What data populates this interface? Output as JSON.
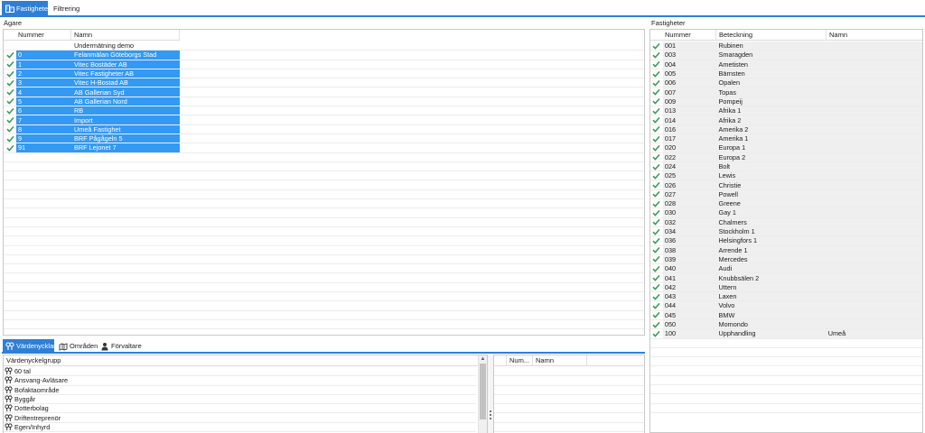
{
  "top_tabs": [
    {
      "label": "Fastigheter",
      "active": true
    },
    {
      "label": "Filtrering",
      "active": false
    }
  ],
  "owners": {
    "title": "Ägare",
    "columns": [
      "Nummer",
      "Namn"
    ],
    "rows": [
      {
        "num": "",
        "name": "Undermätning demo",
        "checked": false,
        "selected": false
      },
      {
        "num": "0",
        "name": "Felanmälan Göteborgs Stad",
        "checked": true,
        "selected": true
      },
      {
        "num": "1",
        "name": "Vitec Bostäder AB",
        "checked": true,
        "selected": true
      },
      {
        "num": "2",
        "name": "Vitec Fastigheter AB",
        "checked": true,
        "selected": true
      },
      {
        "num": "3",
        "name": "Vitec H-Bostad AB",
        "checked": true,
        "selected": true
      },
      {
        "num": "4",
        "name": "AB Gallerian Syd",
        "checked": true,
        "selected": true
      },
      {
        "num": "5",
        "name": "AB Gallerian Nord",
        "checked": true,
        "selected": true
      },
      {
        "num": "6",
        "name": "RB",
        "checked": true,
        "selected": true
      },
      {
        "num": "7",
        "name": "Import",
        "checked": true,
        "selected": true
      },
      {
        "num": "8",
        "name": "Umeå Fastighet",
        "checked": true,
        "selected": true
      },
      {
        "num": "9",
        "name": "BRF Pågågeln 5",
        "checked": true,
        "selected": true
      },
      {
        "num": "91",
        "name": "BRF Lejonet 7",
        "checked": true,
        "selected": true
      }
    ]
  },
  "properties": {
    "title": "Fastigheter",
    "columns": [
      "Nummer",
      "Beteckning",
      "Namn"
    ],
    "rows": [
      {
        "num": "001",
        "name": "Rubinen",
        "extra": ""
      },
      {
        "num": "003",
        "name": "Smaragden",
        "extra": ""
      },
      {
        "num": "004",
        "name": "Ametisten",
        "extra": ""
      },
      {
        "num": "005",
        "name": "Bärnsten",
        "extra": ""
      },
      {
        "num": "006",
        "name": "Opalen",
        "extra": ""
      },
      {
        "num": "007",
        "name": "Topas",
        "extra": ""
      },
      {
        "num": "009",
        "name": "Pompeij",
        "extra": ""
      },
      {
        "num": "013",
        "name": "Afrika 1",
        "extra": ""
      },
      {
        "num": "014",
        "name": "Afrika 2",
        "extra": ""
      },
      {
        "num": "016",
        "name": "Amerika 2",
        "extra": ""
      },
      {
        "num": "017",
        "name": "Amerika 1",
        "extra": ""
      },
      {
        "num": "020",
        "name": "Europa 1",
        "extra": ""
      },
      {
        "num": "022",
        "name": "Europa 2",
        "extra": ""
      },
      {
        "num": "024",
        "name": "Bolt",
        "extra": ""
      },
      {
        "num": "025",
        "name": "Lewis",
        "extra": ""
      },
      {
        "num": "026",
        "name": "Christie",
        "extra": ""
      },
      {
        "num": "027",
        "name": "Powell",
        "extra": ""
      },
      {
        "num": "028",
        "name": "Greene",
        "extra": ""
      },
      {
        "num": "030",
        "name": "Gay 1",
        "extra": ""
      },
      {
        "num": "032",
        "name": "Chalmers",
        "extra": ""
      },
      {
        "num": "034",
        "name": "Stockholm 1",
        "extra": ""
      },
      {
        "num": "036",
        "name": "Helsingfors 1",
        "extra": ""
      },
      {
        "num": "038",
        "name": "Arrende 1",
        "extra": ""
      },
      {
        "num": "039",
        "name": "Mercedes",
        "extra": ""
      },
      {
        "num": "040",
        "name": "Audi",
        "extra": ""
      },
      {
        "num": "041",
        "name": "Knubbsälen 2",
        "extra": ""
      },
      {
        "num": "042",
        "name": "Uttern",
        "extra": ""
      },
      {
        "num": "043",
        "name": "Laxen",
        "extra": ""
      },
      {
        "num": "044",
        "name": "Volvo",
        "extra": ""
      },
      {
        "num": "045",
        "name": "BMW",
        "extra": ""
      },
      {
        "num": "050",
        "name": "Momondo",
        "extra": ""
      },
      {
        "num": "100",
        "name": "Upphandling",
        "extra": "Umeå"
      }
    ]
  },
  "bottom_tabs": [
    {
      "label": "Värdenycklar",
      "active": true,
      "icon": "key-icon"
    },
    {
      "label": "Områden",
      "active": false,
      "icon": "map-icon"
    },
    {
      "label": "Förvaltare",
      "active": false,
      "icon": "person-icon"
    }
  ],
  "key_groups": {
    "column": "Värdenyckelgrupp",
    "items": [
      "60 tal",
      "Ansvang-Avläsare",
      "Bofaktaområde",
      "Byggår",
      "Dotterbolag",
      "Driftentreprenör",
      "Egen/Inhyrd"
    ]
  },
  "key_values": {
    "columns": [
      "Num...",
      "Namn"
    ]
  },
  "colors": {
    "accent": "#2f7fd6",
    "selection": "#3399f3",
    "check": "#3a9a55"
  }
}
